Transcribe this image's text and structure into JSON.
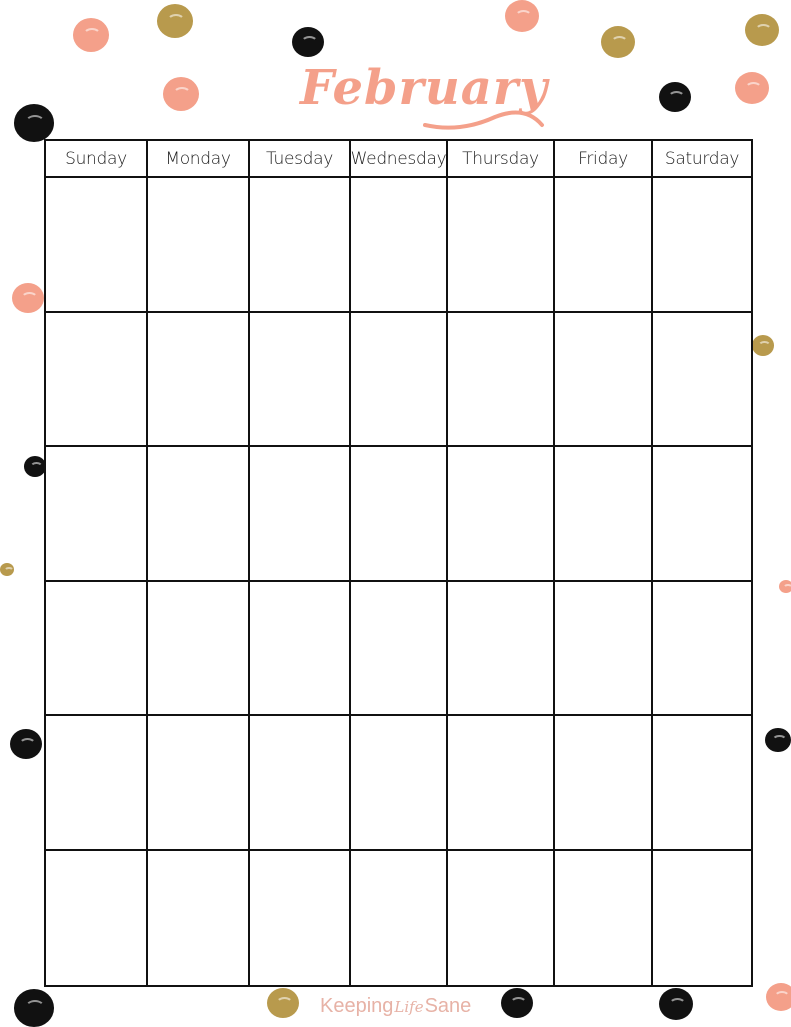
{
  "title": "February",
  "weekdays": [
    "Sunday",
    "Monday",
    "Tuesday",
    "Wednesday",
    "Thursday",
    "Friday",
    "Saturday"
  ],
  "weeks": 6,
  "footer": {
    "part1": "Keeping",
    "part2": "Life",
    "part3": "Sane"
  },
  "colors": {
    "pink": "#f4a08a",
    "gold": "#b89a4d",
    "black": "#111111",
    "footer_text": "#e7b2a6"
  },
  "decorations": {
    "icon": "scribble-dot-icon",
    "dots": [
      {
        "color": "pink"
      },
      {
        "color": "gold"
      },
      {
        "color": "pink"
      },
      {
        "color": "black"
      },
      {
        "color": "black"
      },
      {
        "color": "pink"
      },
      {
        "color": "gold"
      },
      {
        "color": "black"
      },
      {
        "color": "gold"
      },
      {
        "color": "pink"
      },
      {
        "color": "pink"
      },
      {
        "color": "black"
      },
      {
        "color": "gold"
      },
      {
        "color": "gold"
      },
      {
        "color": "pink"
      },
      {
        "color": "black"
      },
      {
        "color": "black"
      },
      {
        "color": "black"
      },
      {
        "color": "gold"
      },
      {
        "color": "black"
      },
      {
        "color": "black"
      },
      {
        "color": "pink"
      }
    ]
  }
}
